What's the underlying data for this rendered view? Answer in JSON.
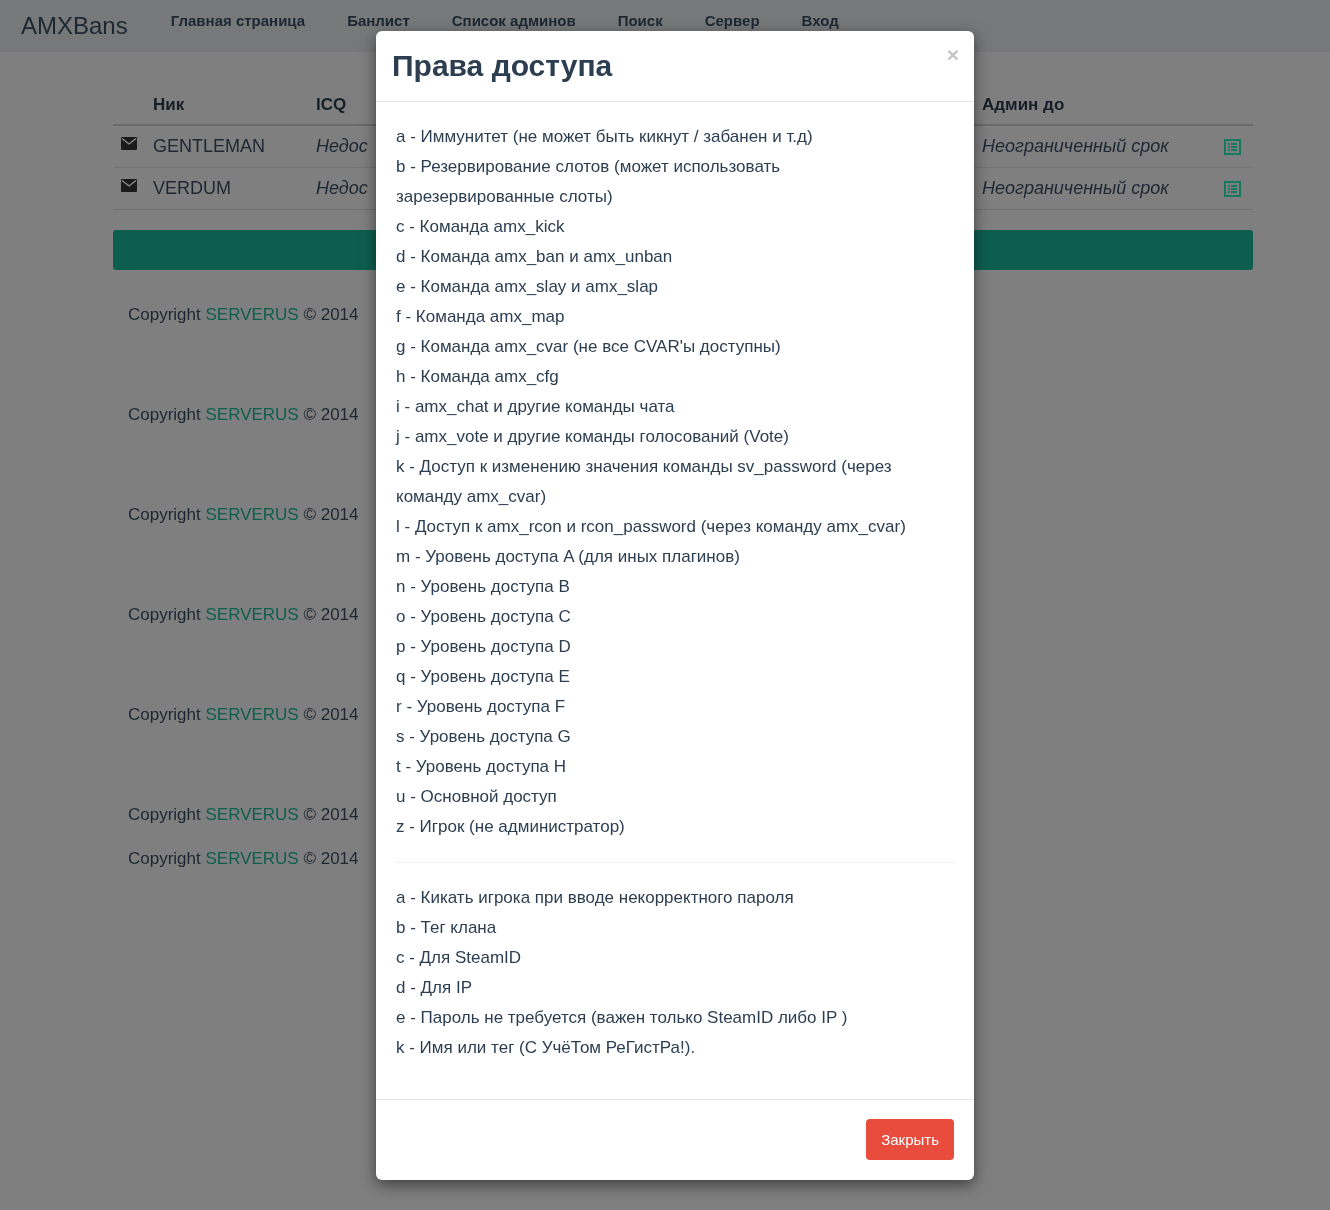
{
  "navbar": {
    "brand": "AMXBans",
    "items": [
      "Главная страница",
      "Банлист",
      "Список админов",
      "Поиск",
      "Сервер",
      "Вход"
    ]
  },
  "table": {
    "columns": [
      "Ник",
      "ICQ",
      "Админ до"
    ],
    "rows": [
      {
        "nick": "GENTLEMAN",
        "icq": "Недос",
        "admin_until": "Неограниченный срок"
      },
      {
        "nick": "VERDUM",
        "icq": "Недос",
        "admin_until": "Неограниченный срок"
      }
    ]
  },
  "footer": {
    "copyrights": [
      {
        "text": "Copyright",
        "link": "SERVERUS",
        "year": "© 2014"
      },
      {
        "text": "Copyright",
        "link": "SERVERUS",
        "year": "© 2014"
      },
      {
        "text": "Copyright",
        "link": "SERVERUS",
        "year": "© 2014"
      },
      {
        "text": "Copyright",
        "link": "SERVERUS",
        "year": "© 2014"
      },
      {
        "text": "Copyright",
        "link": "SERVERUS",
        "year": "© 2014"
      },
      {
        "text": "Copyright",
        "link": "SERVERUS",
        "year": "© 2014"
      },
      {
        "text": "Copyright",
        "link": "SERVERUS",
        "year": "© 2014"
      }
    ]
  },
  "modal": {
    "title": "Права доступа",
    "close": "×",
    "access_flags": [
      "a - Иммунитет (не может быть кикнут / забанен и т.д)",
      "b - Резервирование слотов (может использовать зарезервированные слоты)",
      "c - Команда amx_kick",
      "d - Команда amx_ban и amx_unban",
      "e - Команда amx_slay и amx_slap",
      "f - Команда amx_map",
      "g - Команда amx_cvar (не все CVAR'ы доступны)",
      "h - Команда amx_cfg",
      "i - amx_chat и другие команды чата",
      "j - amx_vote и другие команды голосований (Vote)",
      "k - Доступ к изменению значения команды sv_password (через команду amx_cvar)",
      "l - Доступ к amx_rcon и rcon_password (через команду amx_cvar)",
      "m - Уровень доступа A (для иных плагинов)",
      "n - Уровень доступа B",
      "o - Уровень доступа C",
      "p - Уровень доступа D",
      "q - Уровень доступа E",
      "r - Уровень доступа F",
      "s - Уровень доступа G",
      "t - Уровень доступа H",
      "u - Основной доступ",
      "z - Игрок (не администратор)"
    ],
    "account_flags": [
      "a - Кикать игрока при вводе некорректного пароля",
      "b - Тег клана",
      "c - Для SteamID",
      "d - Для IP",
      "e - Пароль не требуется (важен только SteamID либо IP )",
      "k - Имя или тег (С УчёТом РеГистРа!)."
    ],
    "close_button": "Закрыть"
  }
}
